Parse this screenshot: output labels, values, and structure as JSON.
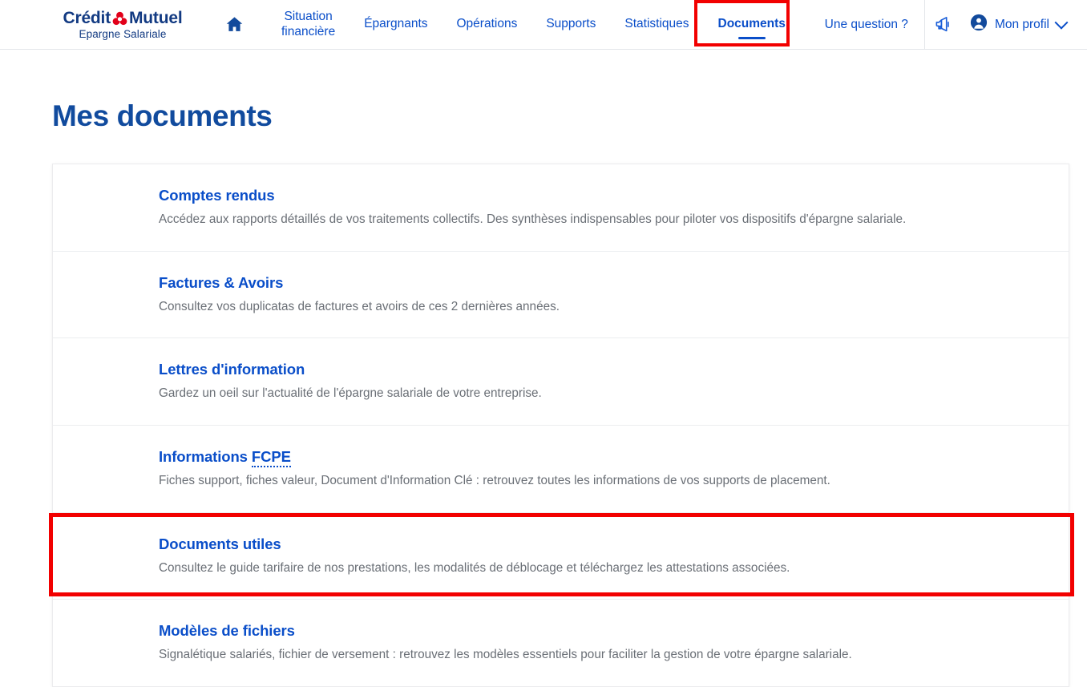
{
  "brand": {
    "name_part1": "Crédit",
    "name_part2": "Mutuel",
    "tagline": "Epargne Salariale",
    "logo_icon": "credit-mutuel-trefoil-icon",
    "navy": "#123a82",
    "red": "#e2001a"
  },
  "header": {
    "home_icon": "home-icon",
    "nav": [
      {
        "label": "Situation\nfinancière",
        "line1": "Situation",
        "line2": "financière",
        "active": false,
        "two_line": true
      },
      {
        "label": "Épargnants",
        "active": false,
        "two_line": false
      },
      {
        "label": "Opérations",
        "active": false,
        "two_line": false
      },
      {
        "label": "Supports",
        "active": false,
        "two_line": false
      },
      {
        "label": "Statistiques",
        "active": false,
        "two_line": false
      },
      {
        "label": "Documents",
        "active": true,
        "two_line": false
      }
    ],
    "question_label": "Une question ?",
    "megaphone_icon": "megaphone-icon",
    "avatar_icon": "user-avatar-icon",
    "profile_label": "Mon profil",
    "chevron_icon": "chevron-down-icon",
    "link_color": "#0a4ec9"
  },
  "main": {
    "page_title": "Mes documents",
    "documents": [
      {
        "title": "Comptes rendus",
        "description": "Accédez aux rapports détaillés de vos traitements collectifs. Des synthèses indispensables pour piloter vos dispositifs d'épargne salariale.",
        "highlighted": false
      },
      {
        "title": "Factures & Avoirs",
        "description": "Consultez vos duplicatas de factures et avoirs de ces 2 dernières années.",
        "highlighted": false
      },
      {
        "title": "Lettres d'information",
        "description": "Gardez un oeil sur l'actualité de l'épargne salariale de votre entreprise.",
        "highlighted": false
      },
      {
        "title": "Informations FCPE",
        "title_prefix": "Informations ",
        "title_abbr": "FCPE",
        "description": "Fiches support, fiches valeur, Document d'Information Clé : retrouvez toutes les informations de vos supports de placement.",
        "highlighted": false,
        "has_abbr": true
      },
      {
        "title": "Documents utiles",
        "description": "Consultez le guide tarifaire de nos prestations, les modalités de déblocage et téléchargez les attestations associées.",
        "highlighted": true
      },
      {
        "title": "Modèles de fichiers",
        "description": "Signalétique salariés, fichier de versement : retrouvez les modèles essentiels pour faciliter la gestion de votre épargne salariale.",
        "highlighted": false
      }
    ]
  },
  "annotations": {
    "color": "#f20000",
    "targets": [
      "documents-nav-tab",
      "documents-utiles-row"
    ]
  }
}
